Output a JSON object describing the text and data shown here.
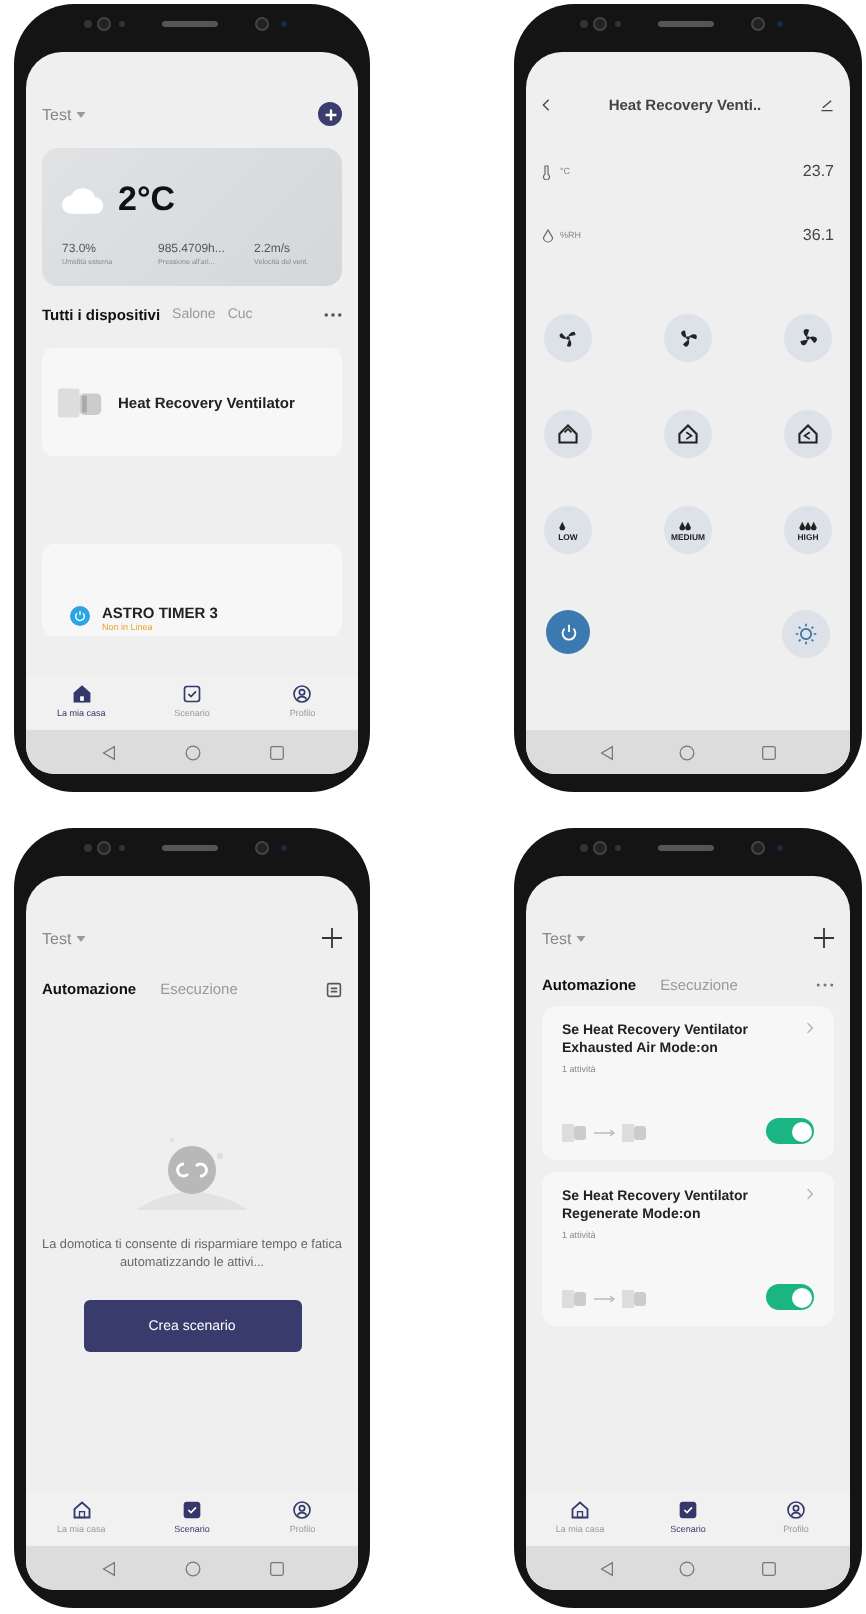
{
  "home_screen": {
    "home_name": "Test",
    "weather": {
      "temperature": "2°C",
      "stats": [
        {
          "value": "73.0%",
          "label": "Umidità esterna"
        },
        {
          "value": "985.4709h...",
          "label": "Pressione all'ari..."
        },
        {
          "value": "2.2m/s",
          "label": "Velocità del vent."
        }
      ]
    },
    "rooms": [
      {
        "label": "Tutti i dispositivi",
        "selected": true
      },
      {
        "label": "Salone",
        "selected": false
      },
      {
        "label": "Cuc",
        "selected": false
      }
    ],
    "devices": [
      {
        "kind": "ventilator",
        "name": "Heat Recovery Ventilator"
      },
      {
        "kind": "timer",
        "name": "ASTRO TIMER 3",
        "status": "Non in Linea"
      }
    ],
    "bottom_tabs": [
      {
        "kind": "home",
        "label": "La mia casa",
        "selected": true
      },
      {
        "kind": "scene",
        "label": "Scenario",
        "selected": false
      },
      {
        "kind": "profile",
        "label": "Profilo",
        "selected": false
      }
    ]
  },
  "device_screen": {
    "title": "Heat Recovery Venti..",
    "readings": [
      {
        "kind": "temperature",
        "unit": "°C",
        "value": "23.7"
      },
      {
        "kind": "humidity",
        "unit": "%RH",
        "value": "36.1"
      }
    ],
    "modes": [
      {
        "kind": "fan"
      },
      {
        "kind": "fan"
      },
      {
        "kind": "fan"
      },
      {
        "kind": "house"
      },
      {
        "kind": "house"
      },
      {
        "kind": "house"
      },
      {
        "kind": "humidity",
        "caption": "LOW"
      },
      {
        "kind": "humidity",
        "caption": "MEDIUM"
      },
      {
        "kind": "humidity",
        "caption": "HIGH"
      }
    ],
    "power_on": true
  },
  "scenario_empty_screen": {
    "home_name": "Test",
    "tabs": [
      {
        "label": "Automazione",
        "selected": true
      },
      {
        "label": "Esecuzione",
        "selected": false
      }
    ],
    "message": "La domotica ti consente di risparmiare tempo e fatica automatizzando le attivi...",
    "create_button": "Crea scenario",
    "bottom_tabs": [
      {
        "kind": "home",
        "label": "La mia casa",
        "selected": false
      },
      {
        "kind": "scene",
        "label": "Scenario",
        "selected": true
      },
      {
        "kind": "profile",
        "label": "Profilo",
        "selected": false
      }
    ]
  },
  "automation_screen": {
    "home_name": "Test",
    "tabs": [
      {
        "label": "Automazione",
        "selected": true
      },
      {
        "label": "Esecuzione",
        "selected": false
      }
    ],
    "automations": [
      {
        "title": "Se Heat Recovery Ventilator Exhausted Air Mode:on",
        "tasks": "1 attività",
        "on": true
      },
      {
        "title": "Se Heat Recovery Ventilator Regenerate Mode:on",
        "tasks": "1 attività",
        "on": true
      }
    ],
    "bottom_tabs": [
      {
        "kind": "home",
        "label": "La mia casa",
        "selected": false
      },
      {
        "kind": "scene",
        "label": "Scenario",
        "selected": true
      },
      {
        "kind": "profile",
        "label": "Profilo",
        "selected": false
      }
    ]
  }
}
